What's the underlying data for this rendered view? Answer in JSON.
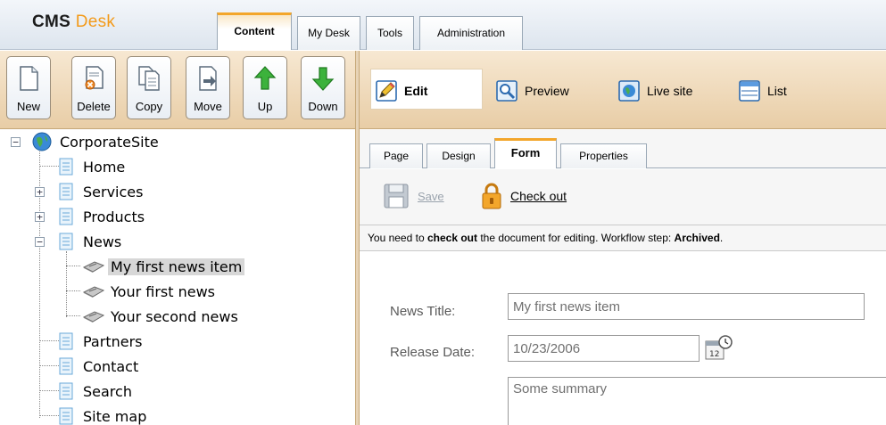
{
  "app": {
    "logo_main": "CMS",
    "logo_accent": "Desk"
  },
  "main_tabs": [
    {
      "label": "Content",
      "active": true
    },
    {
      "label": "My Desk",
      "active": false
    },
    {
      "label": "Tools",
      "active": false
    },
    {
      "label": "Administration",
      "active": false
    }
  ],
  "toolbar": {
    "new": "New",
    "delete": "Delete",
    "copy": "Copy",
    "move": "Move",
    "up": "Up",
    "down": "Down"
  },
  "view_modes": {
    "edit": "Edit",
    "preview": "Preview",
    "live_site": "Live site",
    "list": "List"
  },
  "tree": {
    "root": "CorporateSite",
    "items": {
      "home": "Home",
      "services": "Services",
      "products": "Products",
      "news": "News",
      "news_item_1": "My first news item",
      "news_item_2": "Your first news",
      "news_item_3": "Your second news",
      "partners": "Partners",
      "contact": "Contact",
      "search": "Search",
      "site_map": "Site map"
    },
    "selected": "My first news item"
  },
  "sub_tabs": [
    {
      "label": "Page",
      "active": false
    },
    {
      "label": "Design",
      "active": false
    },
    {
      "label": "Form",
      "active": true
    },
    {
      "label": "Properties",
      "active": false
    }
  ],
  "actions": {
    "save": "Save",
    "check_out": "Check out"
  },
  "info": {
    "prefix": "You need to ",
    "strong": "check out",
    "middle": " the document for editing. Workflow step: ",
    "step": "Archived",
    "suffix": "."
  },
  "form": {
    "news_title_label": "News Title:",
    "news_title_value": "My first news item",
    "release_date_label": "Release Date:",
    "release_date_value": "10/23/2006",
    "summary_value": "Some summary"
  },
  "colors": {
    "accent": "#f3a62b",
    "toolbar_bg": "#e8cda6",
    "logo_accent": "#f39a1a"
  }
}
